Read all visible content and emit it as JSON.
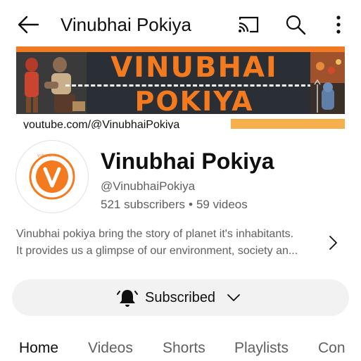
{
  "topbar": {
    "title": "Vinubhai Pokiya",
    "icons": [
      "back-arrow-icon",
      "cast-icon",
      "search-icon",
      "more-vert-icon"
    ]
  },
  "banner": {
    "line1": "VINUBHAI",
    "line2": "POKIYA",
    "url": "youtube.com/@VinubhaiPokiya"
  },
  "channel": {
    "name": "Vinubhai Pokiya",
    "handle": "@VinubhaiPokiya",
    "subscribers": "521 subscribers",
    "separator": "•",
    "videos": "59 videos",
    "avatar_letter": "V",
    "avatar_ring_text": "VINUBHAI",
    "description_line1": "Vinubhai pokiya bring the story of planet it's inhabitants.",
    "description_line2": "It provides us a glimpse of our environment, society an..."
  },
  "subscribe": {
    "label": "Subscribed"
  },
  "tabs": [
    {
      "label": "Home",
      "active": true
    },
    {
      "label": "Videos",
      "active": false
    },
    {
      "label": "Shorts",
      "active": false
    },
    {
      "label": "Playlists",
      "active": false
    },
    {
      "label": "Con",
      "active": false
    }
  ],
  "colors": {
    "brand_orange": "#f47a1f",
    "text_primary": "#0f0f0f",
    "text_secondary": "#606060",
    "pill_bg": "#f2f2f2"
  }
}
